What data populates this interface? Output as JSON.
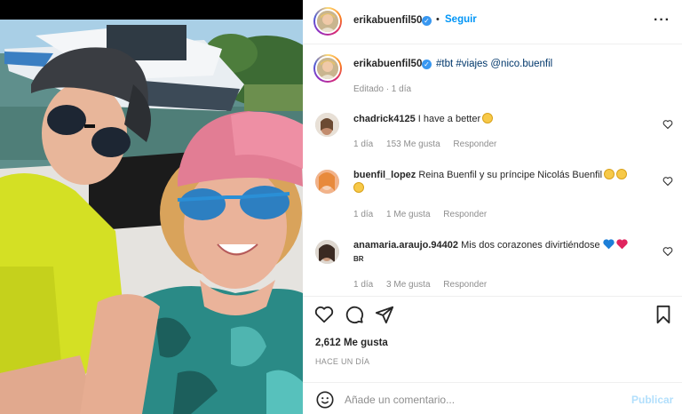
{
  "post": {
    "photo_icon": "selfie-photo",
    "author": "erikabuenfil50",
    "follow_label": "Seguir",
    "separator": "•",
    "more_label": "···",
    "verified_icon": "✓"
  },
  "caption": {
    "author": "erikabuenfil50",
    "text": "#tbt #viajes @nico.buenfil",
    "meta": "Editado · 1 día"
  },
  "comments": [
    {
      "user": "chadrick4125",
      "text": "I have a better",
      "emoji": "smiling-face",
      "time": "1 día",
      "likes": "153 Me gusta",
      "reply": "Responder"
    },
    {
      "user": "buenfil_lopez",
      "text": "Reina Buenfil y su príncipe Nicolás Buenfil",
      "emoji": "heart-eyes-face",
      "time": "1 día",
      "likes": "1 Me gusta",
      "reply": "Responder"
    },
    {
      "user": "anamaria.araujo.94402",
      "text": "Mis dos corazones divirtiéndose",
      "emoji": "blue-heart red-heart",
      "flag": "BR",
      "time": "1 día",
      "likes": "3 Me gusta",
      "reply": "Responder"
    }
  ],
  "stats": {
    "likes": "2,612 Me gusta",
    "time": "HACE UN DÍA"
  },
  "composer": {
    "placeholder": "Añade un comentario...",
    "publish_label": "Publicar"
  },
  "colors": {
    "accent": "#0095f6",
    "publish_disabled": "#b2dffc",
    "muted": "#8e8e8e",
    "text": "#262626"
  }
}
